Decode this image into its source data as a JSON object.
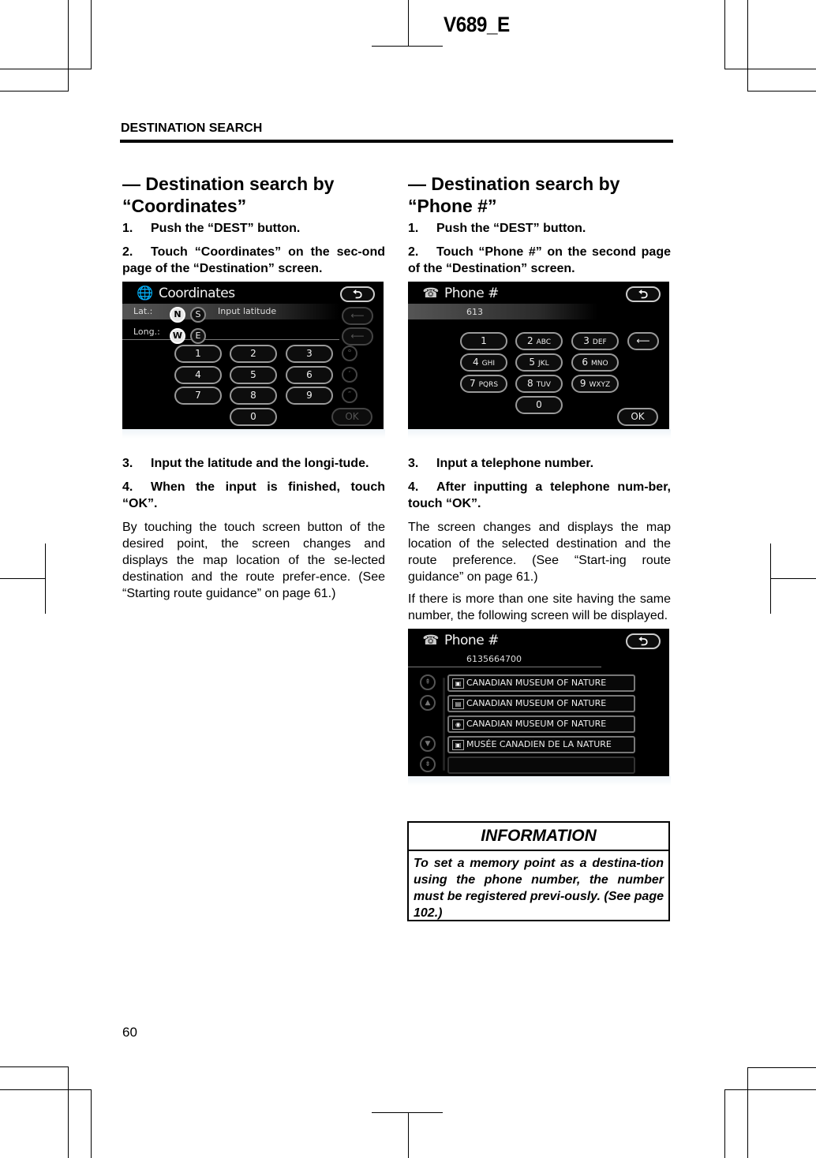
{
  "page": {
    "doc_id": "V689_E",
    "section_header": "DESTINATION SEARCH",
    "page_number": "60"
  },
  "coordinates_section": {
    "title_line1": "— Destination search by",
    "title_line2": "“Coordinates”",
    "steps": [
      {
        "num": "1.",
        "text": "Push the “DEST” button."
      },
      {
        "num": "2.",
        "text": "Touch “Coordinates” on the sec-ond page of the “Destination” screen."
      },
      {
        "num": "3.",
        "text": "Input the latitude and the longi-tude."
      },
      {
        "num": "4.",
        "text": "When the input is finished, touch “OK”."
      }
    ],
    "paragraph": "By touching the touch screen button of the desired point, the screen changes and displays the map location of the se-lected destination and the route prefer-ence.   (See “Starting route guidance” on page 61.)",
    "screen": {
      "title": "Coordinates",
      "icon": "globe-icon",
      "back_icon": "⮌",
      "lat_label": "Lat.:",
      "long_label": "Long.:",
      "lat_options": [
        "N",
        "S"
      ],
      "lat_selected": "N",
      "long_options": [
        "W",
        "E"
      ],
      "long_selected": "W",
      "lat_placeholder": "Input latitude",
      "keys": [
        "1",
        "2",
        "3",
        "4",
        "5",
        "6",
        "7",
        "8",
        "9",
        "0"
      ],
      "side_keys": [
        "°",
        "′",
        "″"
      ],
      "delete_icon": "⟵",
      "ok_label": "OK"
    }
  },
  "phone_section": {
    "title_line1": "— Destination search by",
    "title_line2": "“Phone #”",
    "steps": [
      {
        "num": "1.",
        "text": "Push the “DEST” button."
      },
      {
        "num": "2.",
        "text": "Touch “Phone #” on the second page of the “Destination” screen."
      },
      {
        "num": "3.",
        "text": "Input a telephone number."
      },
      {
        "num": "4.",
        "text": "After inputting a telephone num-ber, touch “OK”."
      }
    ],
    "paragraph1": "The screen changes and displays the map location of the selected destination and the route preference.  (See “Start-ing route guidance” on page 61.)",
    "paragraph2": "If there is more than one site having the same number, the following screen will be displayed.",
    "keypad_screen": {
      "title": "Phone #",
      "icon": "phone-icon",
      "entered_number": "613",
      "keys": [
        {
          "digit": "1",
          "letters": ""
        },
        {
          "digit": "2",
          "letters": "ABC"
        },
        {
          "digit": "3",
          "letters": "DEF"
        },
        {
          "digit": "4",
          "letters": "GHI"
        },
        {
          "digit": "5",
          "letters": "JKL"
        },
        {
          "digit": "6",
          "letters": "MNO"
        },
        {
          "digit": "7",
          "letters": "PQRS"
        },
        {
          "digit": "8",
          "letters": "TUV"
        },
        {
          "digit": "9",
          "letters": "WXYZ"
        },
        {
          "digit": "0",
          "letters": ""
        }
      ],
      "ok_label": "OK"
    },
    "results_screen": {
      "title": "Phone #",
      "number": "6135664700",
      "results": [
        {
          "name": "CANADIAN MUSEUM OF NATURE",
          "icon": "poi-museum-icon"
        },
        {
          "name": "CANADIAN MUSEUM OF NATURE",
          "icon": "poi-building-icon"
        },
        {
          "name": "CANADIAN MUSEUM OF NATURE",
          "icon": "poi-landmark-icon"
        },
        {
          "name": "MUSÉE CANADIEN DE LA NATURE",
          "icon": "poi-museum-icon"
        },
        {
          "name": "",
          "icon": ""
        }
      ]
    }
  },
  "information": {
    "title": "INFORMATION",
    "body": "To set a memory point as a destina-tion using the phone number, the number must be registered previ-ously.   (See page 102.)"
  }
}
